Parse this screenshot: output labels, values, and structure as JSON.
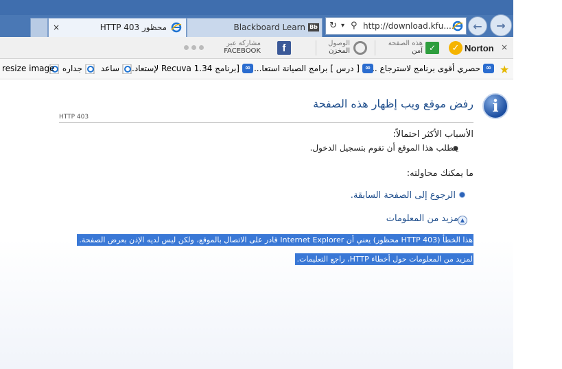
{
  "tabs": [
    {
      "title": "HTTP 403 محظور",
      "active": true,
      "close": "×"
    },
    {
      "title": "Blackboard Learn",
      "badge": "Bb",
      "active": false
    }
  ],
  "address_bar": {
    "url": "http://download.kfu....",
    "refresh_icon": "↻",
    "dropdown_icon": "▾",
    "search_icon": "⚲"
  },
  "nav": {
    "back_icon": "←",
    "forward_icon": "→"
  },
  "norton_toolbar": {
    "brand": "Norton",
    "close": "×",
    "page_label": "هذه الصفحة",
    "page_status": "آمن",
    "storage_label": "الوصول",
    "storage_sub": "المخزن",
    "share_label": "مشاركة عبر",
    "share_target": "FACEBOOK"
  },
  "favorites": [
    {
      "label": "حصري أقوى برنامج لاسترجاع ...",
      "icon": "bluelink-icon"
    },
    {
      "label": "[ درس ] برامج الصيانة استعا...",
      "icon": "bluelink-icon"
    },
    {
      "label": "[برنامج Recuva 1.34 لإستعاد...",
      "icon": "bluelink-icon"
    },
    {
      "label": "ساعد",
      "icon": "ie-page-icon"
    },
    {
      "label": "جداره",
      "icon": "ie-page-icon"
    },
    {
      "label": "resize image",
      "icon": "ie-page-icon"
    }
  ],
  "error_page": {
    "title": "رفض موقع ويب إظهار هذه الصفحة",
    "code": "HTTP 403",
    "reasons_heading": "الأسباب الأكثر احتمالاً:",
    "reason": "يتطلب هذا الموقع أن تقوم بتسجيل الدخول.",
    "try_heading": "ما يمكنك محاولته:",
    "back_link": "الرجوع إلى الصفحة السابقة.",
    "more_info": "مزيد من المعلومات",
    "detail_line1": "هذا الخطأ (HTTP 403 محظور) يعني أن Internet Explorer قادر على الاتصال بالموقع، ولكن ليس لديه الإذن بعرض الصفحة.",
    "detail_line2": "لمزيد من المعلومات حول أخطاء HTTP، راجع التعليمات."
  },
  "colors": {
    "title_blue": "#1f4e8c",
    "selection": "#3a78d6",
    "frame": "#4a78b5"
  }
}
